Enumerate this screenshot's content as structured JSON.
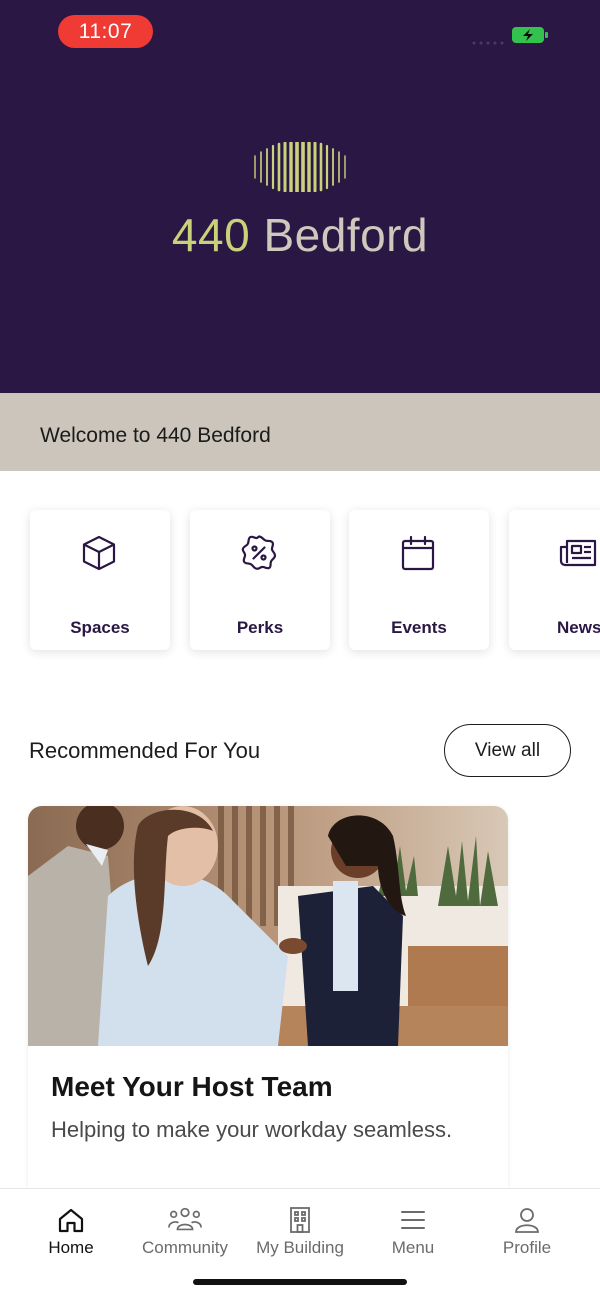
{
  "status_bar": {
    "time": "11:07"
  },
  "header": {
    "logo_number": "440",
    "logo_name": "Bedford",
    "brand_colors": {
      "background": "#2a1744",
      "accent": "#c9d27a"
    }
  },
  "welcome": {
    "text": "Welcome to 440 Bedford"
  },
  "quick_links": [
    {
      "label": "Spaces",
      "icon": "cube-icon"
    },
    {
      "label": "Perks",
      "icon": "badge-percent-icon"
    },
    {
      "label": "Events",
      "icon": "calendar-icon"
    },
    {
      "label": "News",
      "icon": "newspaper-icon"
    }
  ],
  "recommended": {
    "title": "Recommended For You",
    "view_all_label": "View all",
    "cards": [
      {
        "title": "Meet Your Host Team",
        "subtitle": "Helping to make your workday seamless."
      }
    ]
  },
  "bottom_nav": [
    {
      "label": "Home",
      "icon": "home-icon",
      "active": true
    },
    {
      "label": "Community",
      "icon": "community-icon",
      "active": false
    },
    {
      "label": "My Building",
      "icon": "building-icon",
      "active": false
    },
    {
      "label": "Menu",
      "icon": "menu-icon",
      "active": false
    },
    {
      "label": "Profile",
      "icon": "profile-icon",
      "active": false
    }
  ]
}
